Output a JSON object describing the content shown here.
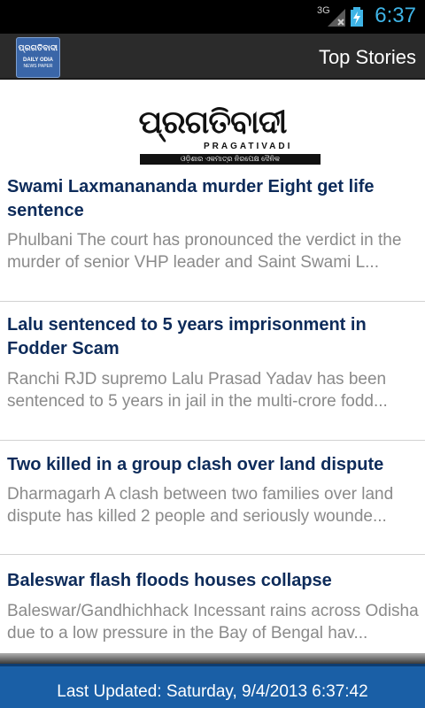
{
  "status_bar": {
    "network": "3G",
    "time": "6:37",
    "accent_color": "#3fb4e6"
  },
  "action_bar": {
    "app_icon": {
      "line1": "ପ୍ରଗତିବାଦୀ",
      "line2": "DAILY ODIA",
      "line3": "NEWS PAPER"
    },
    "title": "Top Stories"
  },
  "logo": {
    "word": "ପ୍ରଗତିବାଦୀ",
    "roman": "PRAGATIVADI",
    "tagline": "ଓଡ଼ିଶାର ଏକମାତ୍ର ନିରପେକ୍ଷ ଦୈନିକ"
  },
  "stories": [
    {
      "title": "Swami Laxmanananda murder  Eight get life sentence",
      "summary": "Phulbani  The court has pronounced the verdict in the murder of senior VHP leader and Saint Swami L..."
    },
    {
      "title": "Lalu sentenced to 5 years imprisonment in Fodder Scam",
      "summary": "Ranchi  RJD supremo Lalu Prasad Yadav has been sentenced to 5 years in jail in the multi-crore fodd..."
    },
    {
      "title": "Two killed in a group clash over land dispute",
      "summary": "Dharmagarh  A clash between two families over land dispute has killed 2 people and seriously wounde..."
    },
    {
      "title": "Baleswar flash floods   houses collapse",
      "summary": "Baleswar/Gandhichhack  Incessant rains across Odisha due to a low pressure in the Bay of Bengal hav..."
    }
  ],
  "footer": {
    "last_updated": "Last Updated: Saturday, 9/4/2013  6:37:42"
  },
  "colors": {
    "headline": "#0d2b5a",
    "summary": "#8a8a8a",
    "footer_bg": "#1a5fa6"
  }
}
